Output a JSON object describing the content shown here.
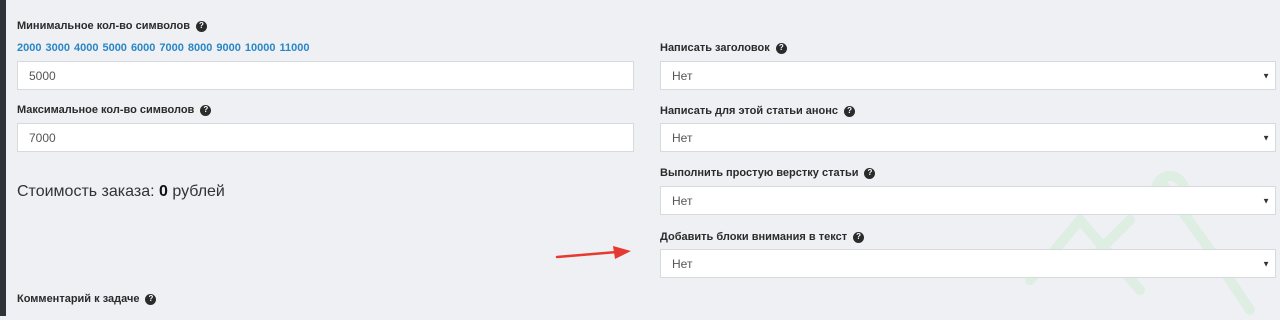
{
  "min_chars": {
    "label": "Минимальное кол-во символов",
    "presets": [
      "2000",
      "3000",
      "4000",
      "5000",
      "6000",
      "7000",
      "8000",
      "9000",
      "10000",
      "11000"
    ],
    "value": "5000"
  },
  "max_chars": {
    "label": "Максимальное кол-во символов",
    "value": "7000"
  },
  "price": {
    "prefix": "Стоимость заказа:",
    "amount": "0",
    "suffix": "рублей"
  },
  "comment": {
    "label": "Комментарий к задаче"
  },
  "options": [
    {
      "label": "Написать заголовок",
      "value": "Нет"
    },
    {
      "label": "Написать для этой статьи анонс",
      "value": "Нет"
    },
    {
      "label": "Выполнить простую верстку статьи",
      "value": "Нет"
    },
    {
      "label": "Добавить блоки внимания в текст",
      "value": "Нет"
    }
  ],
  "icons": {
    "help": "question-circle-icon",
    "caret": "caret-down-icon",
    "arrow": "red-arrow-annotation"
  },
  "colors": {
    "link": "#2a86c6",
    "arrow": "#e53a2f",
    "watermark": "#dfeee3"
  }
}
